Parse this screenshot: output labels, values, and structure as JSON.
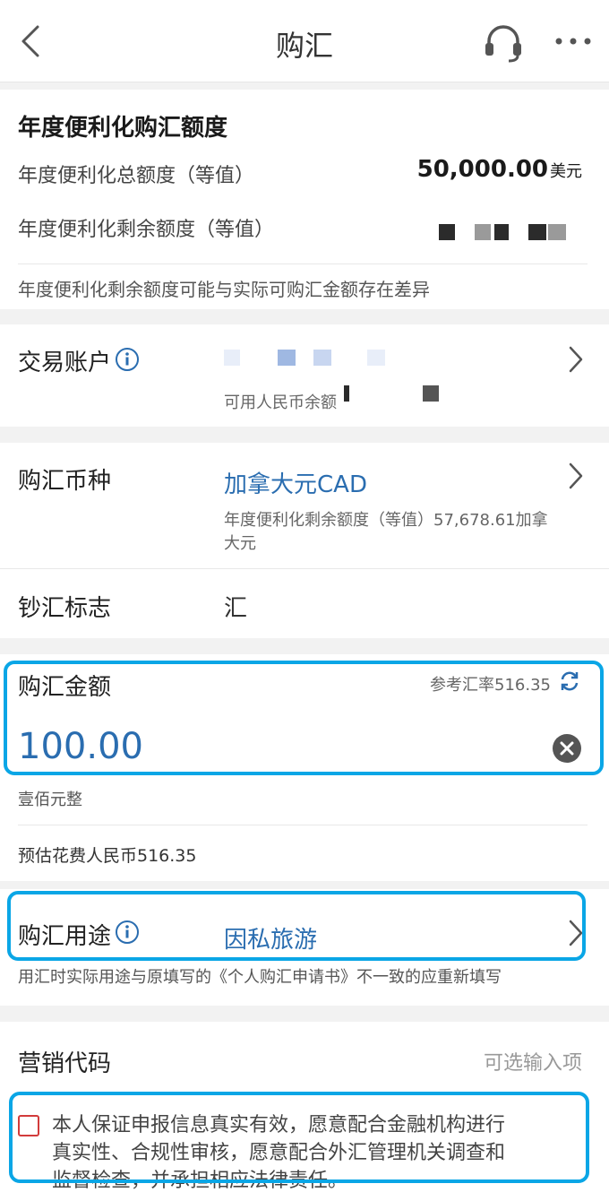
{
  "nav": {
    "title": "购汇"
  },
  "quota": {
    "heading": "年度便利化购汇额度",
    "total_label": "年度便利化总额度（等值）",
    "total_value": "50,000.00",
    "total_unit": "美元",
    "remaining_label": "年度便利化剩余额度（等值）",
    "note": "年度便利化剩余额度可能与实际可购汇金额存在差异"
  },
  "account": {
    "label": "交易账户",
    "balance_label": "可用人民币余额"
  },
  "currency": {
    "label": "购汇币种",
    "value": "加拿大元CAD",
    "remaining_line1": "年度便利化剩余额度（等值）57,678.61加拿",
    "remaining_line2": "大元",
    "cash_flag_label": "钞汇标志",
    "cash_flag_value": "汇"
  },
  "amount": {
    "label": "购汇金额",
    "rate_text": "参考汇率516.35",
    "value": "100.00",
    "in_words": "壹佰元整",
    "estimated_cost": "预估花费人民币516.35"
  },
  "purpose": {
    "label": "购汇用途",
    "value": "因私旅游",
    "hint": "用汇时实际用途与原填写的《个人购汇申请书》不一致的应重新填写"
  },
  "marketing": {
    "label": "营销代码",
    "placeholder": "可选输入项"
  },
  "declaration": {
    "line1": "本人保证申报信息真实有效，愿意配合金融机构进行",
    "line2": "真实性、合规性审核，愿意配合外汇管理机关调查和",
    "line3": "监督检查，并承担相应法律责任。"
  },
  "colors": {
    "accent": "#2a6db0",
    "highlight": "#0aa6e6",
    "checkbox": "#d23b3b"
  }
}
